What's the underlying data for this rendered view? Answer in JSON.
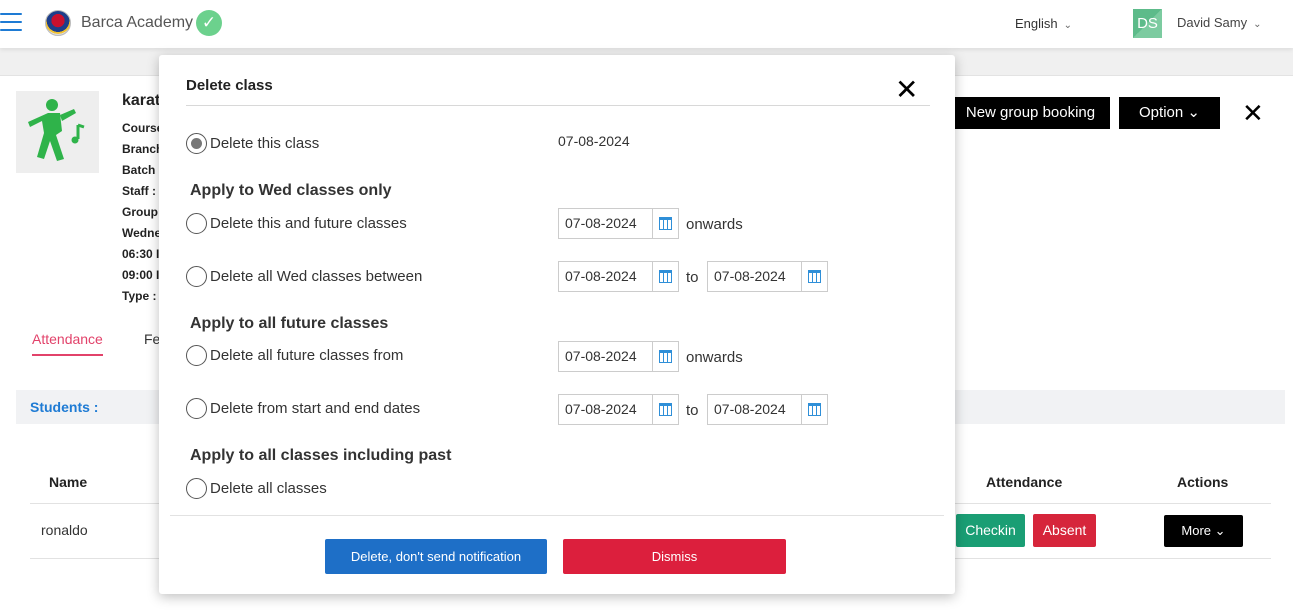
{
  "topbar": {
    "app_name": "Barca Academy",
    "language": "English",
    "avatar_initials": "DS",
    "user_name": "David Samy"
  },
  "class_info": {
    "title": "karat",
    "details": [
      "Course",
      "Branch",
      "Batch :",
      "Staff :",
      "Group",
      "Wedne",
      "06:30 I",
      "09:00 I",
      "Type :"
    ]
  },
  "actions": {
    "new_group_booking": "New group booking",
    "option": "Option"
  },
  "tabs": {
    "attendance": "Attendance",
    "fees_partial": "Fe"
  },
  "students": {
    "label": "Students :",
    "columns": {
      "name": "Name",
      "attendance": "Attendance",
      "actions": "Actions"
    },
    "rows": [
      {
        "name": "ronaldo",
        "checkin": "Checkin",
        "absent": "Absent",
        "more": "More"
      }
    ]
  },
  "modal": {
    "title": "Delete class",
    "option_this": {
      "label": "Delete this class",
      "date": "07-08-2024"
    },
    "section_wed": "Apply to Wed classes only",
    "option_future": {
      "label": "Delete this and future classes",
      "date": "07-08-2024",
      "suffix": "onwards"
    },
    "option_wed_between": {
      "label": "Delete all Wed classes between",
      "from": "07-08-2024",
      "to_word": "to",
      "to": "07-08-2024"
    },
    "section_future": "Apply to all future classes",
    "option_all_future": {
      "label": "Delete all future classes from",
      "date": "07-08-2024",
      "suffix": "onwards"
    },
    "option_range": {
      "label": "Delete from start and end dates",
      "from": "07-08-2024",
      "to_word": "to",
      "to": "07-08-2024"
    },
    "section_past": "Apply to all classes including past",
    "option_all": {
      "label": "Delete all classes"
    },
    "btn_delete": "Delete, don't send notification",
    "btn_dismiss": "Dismiss"
  },
  "colors": {
    "primary_blue": "#1e6fc7",
    "danger_red": "#dc1f3d",
    "success_green": "#1a9e74",
    "tab_accent": "#e2426a"
  }
}
